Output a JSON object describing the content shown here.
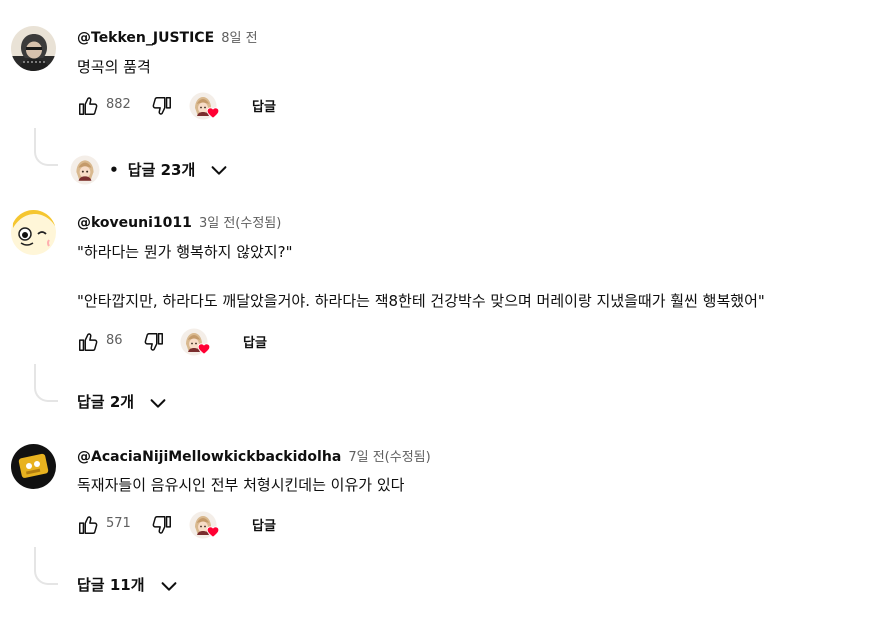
{
  "comments": [
    {
      "author": "@Tekken_JUSTICE",
      "time": "8일 전",
      "lines": [
        "명곡의 품격"
      ],
      "likes": "882",
      "reply_label": "답글",
      "replies_label": "답글 23개",
      "replies_prefix": "•"
    },
    {
      "author": "@koveuni1011",
      "time": "3일 전(수정됨)",
      "lines": [
        "\"하라다는 뭔가 행복하지 않았지?\"",
        "\"안타깝지만, 하라다도 깨달았을거야. 하라다는 잭8한테 건강박수 맞으며 머레이랑 지냈을때가 훨씬 행복했어\""
      ],
      "likes": "86",
      "reply_label": "답글",
      "replies_label": "답글 2개"
    },
    {
      "author": "@AcaciaNijiMellowkickbackidolha",
      "time": "7일 전(수정됨)",
      "lines": [
        "독재자들이 음유시인 전부 처형시킨데는 이유가 있다"
      ],
      "likes": "571",
      "reply_label": "답글",
      "replies_label": "답글 11개"
    }
  ],
  "icons": {
    "like": "thumbs-up-icon",
    "dislike": "thumbs-down-icon",
    "creator_heart": "creator-heart-icon",
    "expand": "chevron-down-icon"
  },
  "colors": {
    "heart": "#ff0033",
    "text_secondary": "#606060"
  }
}
